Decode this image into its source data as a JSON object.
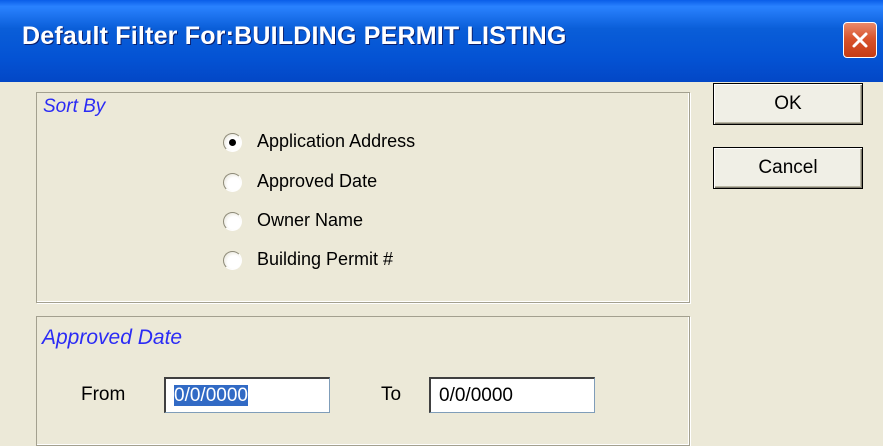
{
  "dialog": {
    "title": "Default Filter For:BUILDING PERMIT LISTING"
  },
  "sort_by": {
    "legend": "Sort By",
    "options": [
      {
        "label": "Application Address",
        "selected": true
      },
      {
        "label": "Approved Date",
        "selected": false
      },
      {
        "label": "Owner Name",
        "selected": false
      },
      {
        "label": "Building Permit #",
        "selected": false
      }
    ]
  },
  "approved_date": {
    "legend": "Approved Date",
    "from_label": "From",
    "from_value": "0/0/0000",
    "to_label": "To",
    "to_value": "0/0/0000"
  },
  "buttons": {
    "ok": "OK",
    "cancel": "Cancel"
  },
  "icons": {
    "close": "close-icon",
    "radio": "radio-button"
  },
  "colors": {
    "titlebar": "#0453d4",
    "legend_text": "#2b2bf5",
    "dialog_bg": "#ece9d8",
    "selection": "#316ac5",
    "close_button": "#d9542d"
  }
}
